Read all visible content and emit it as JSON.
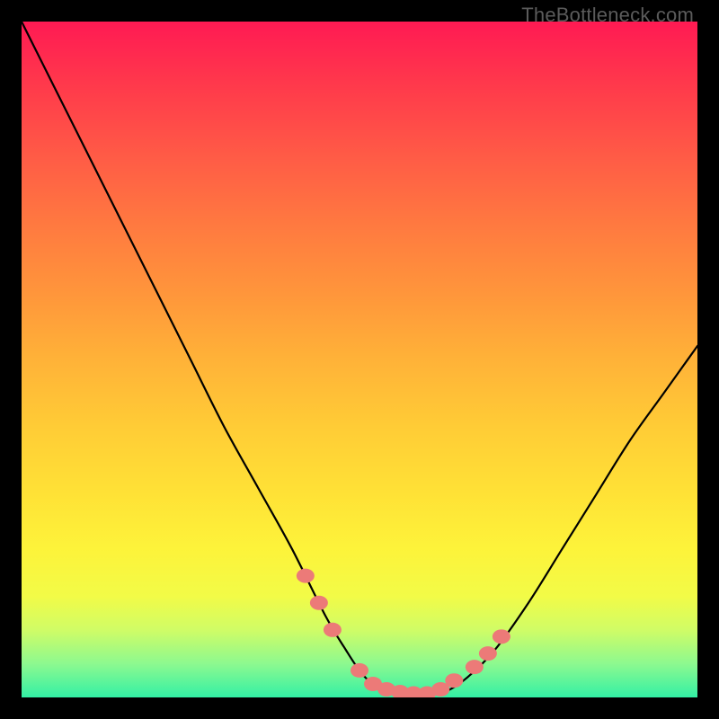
{
  "watermark": "TheBottleneck.com",
  "colors": {
    "curve_stroke": "#000000",
    "marker_fill": "#ec7a78",
    "bg_black": "#000000"
  },
  "chart_data": {
    "type": "line",
    "title": "",
    "xlabel": "",
    "ylabel": "",
    "xlim": [
      0,
      100
    ],
    "ylim": [
      0,
      100
    ],
    "grid": false,
    "legend": false,
    "series": [
      {
        "name": "bottleneck-curve",
        "x": [
          0,
          5,
          10,
          15,
          20,
          25,
          30,
          35,
          40,
          45,
          48,
          50,
          52,
          55,
          58,
          60,
          63,
          66,
          70,
          75,
          80,
          85,
          90,
          95,
          100
        ],
        "y": [
          100,
          90,
          80,
          70,
          60,
          50,
          40,
          31,
          22,
          12,
          7,
          4,
          2,
          1,
          0.5,
          0.5,
          1,
          3,
          7,
          14,
          22,
          30,
          38,
          45,
          52
        ]
      }
    ],
    "markers": {
      "name": "highlight-points",
      "x": [
        42,
        44,
        46,
        50,
        52,
        54,
        56,
        58,
        60,
        62,
        64,
        67,
        69,
        71
      ],
      "y": [
        18,
        14,
        10,
        4,
        2,
        1.2,
        0.8,
        0.6,
        0.6,
        1.2,
        2.5,
        4.5,
        6.5,
        9
      ]
    }
  }
}
